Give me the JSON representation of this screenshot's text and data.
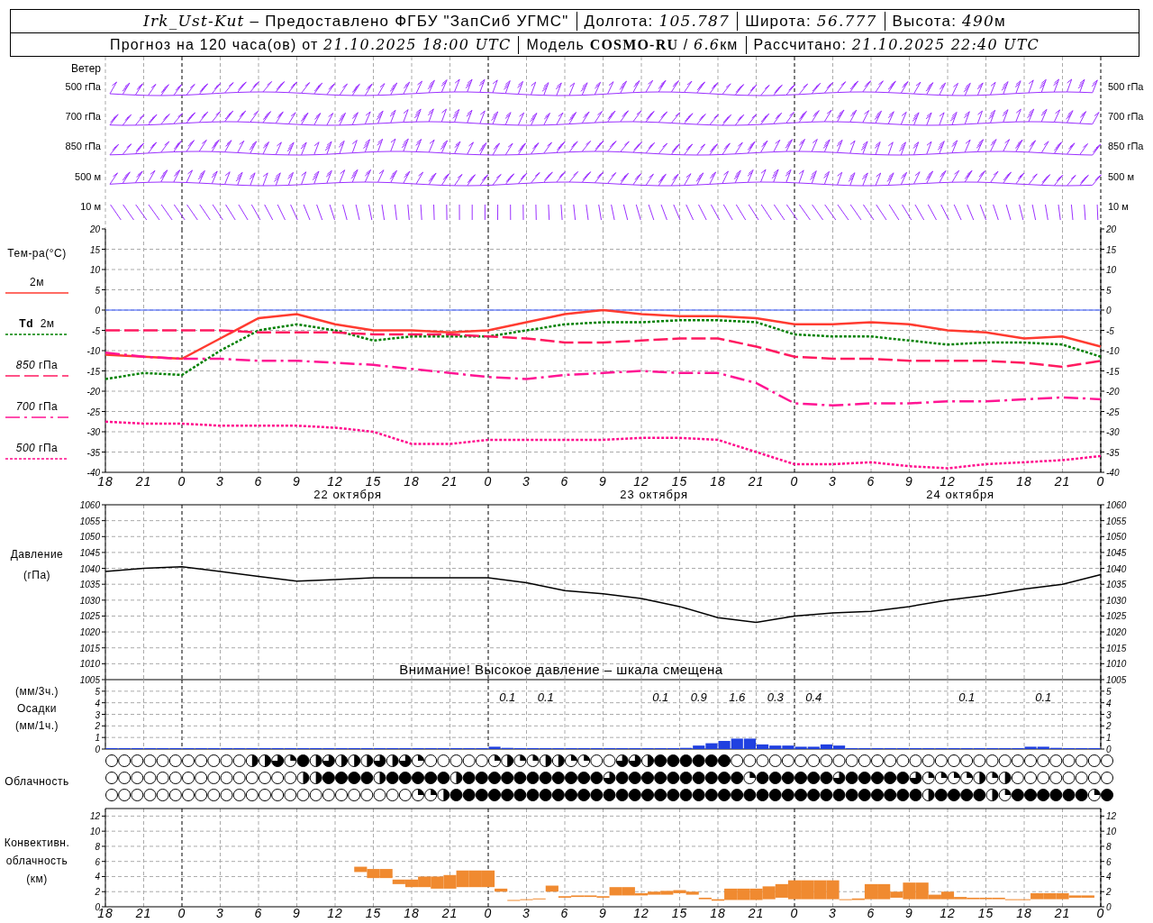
{
  "header": {
    "rows": [
      {
        "segments": [
          {
            "parts": [
              {
                "value": "Irk_Ust-Kut"
              },
              {
                "text": " – Предоставлено ФГБУ \"ЗапСиб УГМС\""
              }
            ]
          },
          {
            "parts": [
              {
                "text": "Долгота: "
              },
              {
                "value": "105.787"
              }
            ]
          },
          {
            "parts": [
              {
                "text": "Широта: "
              },
              {
                "value": "56.777"
              }
            ]
          },
          {
            "parts": [
              {
                "text": "Высота: "
              },
              {
                "value": "490"
              },
              {
                "text": "м"
              }
            ]
          }
        ]
      },
      {
        "segments": [
          {
            "parts": [
              {
                "text": "Прогноз на 120 часа(ов) от "
              },
              {
                "value": "21.10.2025 18:00 UTC"
              }
            ]
          },
          {
            "parts": [
              {
                "text": "Модель "
              },
              {
                "name": "COSMO-RU"
              },
              {
                "text": " / "
              },
              {
                "value": "6.6"
              },
              {
                "text": "км"
              }
            ]
          },
          {
            "parts": [
              {
                "text": "Рассчитано: "
              },
              {
                "value": "21.10.2025 22:40 UTC"
              }
            ]
          }
        ]
      }
    ]
  },
  "wind": {
    "title": "Ветер",
    "levels_left": [
      "500 гПа",
      "700 гПа",
      "850 гПа",
      "500 м",
      "10  м"
    ],
    "levels_right": [
      "500 гПа",
      "700 гПа",
      "850 гПа",
      "500 м",
      "10  м"
    ]
  },
  "temperature": {
    "title": "Тем-ра(°C)",
    "chart_data": {
      "type": "line",
      "grid": true,
      "categories": [
        "18",
        "21",
        "0",
        "3",
        "6",
        "9",
        "12",
        "15",
        "18",
        "21",
        "0",
        "3",
        "6",
        "9",
        "12",
        "15",
        "18",
        "21",
        "0",
        "3",
        "6",
        "9",
        "12",
        "15",
        "18",
        "21",
        "0"
      ],
      "ylim": [
        -40,
        20
      ],
      "yticks": [
        -40,
        -35,
        -30,
        -25,
        -20,
        -15,
        -10,
        -5,
        0,
        5,
        10,
        15,
        20
      ],
      "ref_lines": [
        {
          "axis": "y",
          "value": 0,
          "color": "#3355ff"
        }
      ],
      "series": [
        {
          "name": "2м",
          "color": "#ff3b30",
          "line_style": "solid",
          "values": [
            -11,
            -11.5,
            -12,
            -7,
            -2,
            -1,
            -3.5,
            -5,
            -5,
            -5.5,
            -5,
            -3,
            -1,
            0,
            -1,
            -1.5,
            -1.5,
            -2,
            -3.5,
            -3.5,
            -3,
            -3.5,
            -5,
            -5.5,
            -7,
            -6.5,
            -9
          ]
        },
        {
          "name": "**Td**  2м",
          "color": "#008000",
          "line_style": "dotted",
          "values": [
            -17,
            -15.5,
            -16,
            -10,
            -5,
            -3.5,
            -5,
            -7.5,
            -6.5,
            -6.5,
            -6.5,
            -5,
            -3.5,
            -3,
            -3,
            -2.5,
            -2.5,
            -3,
            -6,
            -6.5,
            -6.5,
            -7.5,
            -8.5,
            -8,
            -8,
            -8.5,
            -11.5
          ]
        },
        {
          "name": "*850* гПа",
          "color": "#ff1a60",
          "line_style": "dashed",
          "values": [
            -5,
            -5,
            -5,
            -5,
            -5.5,
            -5.5,
            -5.5,
            -6,
            -6,
            -6,
            -6.5,
            -7,
            -8,
            -8,
            -7.5,
            -7,
            -7,
            -9,
            -11.5,
            -12,
            -12,
            -12.5,
            -12.5,
            -12.5,
            -13,
            -14,
            -12.5
          ]
        },
        {
          "name": "*700* гПа",
          "color": "#ff1493",
          "line_style": "dashdot",
          "values": [
            -10.5,
            -11.5,
            -12,
            -12,
            -12.5,
            -12.5,
            -13,
            -13.5,
            -14.5,
            -15.5,
            -16.5,
            -17,
            -16,
            -15.5,
            -15,
            -15.5,
            -15.5,
            -18,
            -23,
            -23.5,
            -23,
            -23,
            -22.5,
            -22.5,
            -22,
            -21.5,
            -22
          ]
        },
        {
          "name": "*500* гПа",
          "color": "#ff0a8c",
          "line_style": "dotted",
          "values": [
            -27.5,
            -28,
            -28,
            -28.5,
            -28.5,
            -28.5,
            -29,
            -30,
            -33,
            -33,
            -32,
            -32,
            -32,
            -32,
            -31.5,
            -31.5,
            -32,
            -35,
            -38,
            -38,
            -37.5,
            -38.5,
            -39,
            -38,
            -37.5,
            -37,
            -36
          ]
        }
      ]
    },
    "right_ticks": [
      "20",
      "15",
      "10",
      "5",
      "0",
      "-5",
      "-10",
      "-15",
      "-20",
      "-25",
      "-30",
      "-35",
      "-40"
    ],
    "day_labels": [
      "22 октября",
      "23 октября",
      "24 октября"
    ]
  },
  "pressure": {
    "title": "Давление",
    "unit": "(гПа)",
    "chart_data": {
      "type": "line",
      "grid": true,
      "categories": [
        null,
        null,
        null,
        null,
        null,
        null,
        null,
        null,
        null,
        null,
        null,
        null,
        null,
        null,
        null,
        null,
        null,
        null,
        null,
        null,
        null,
        null,
        null,
        null,
        null,
        null,
        null
      ],
      "ylim": [
        1005,
        1060
      ],
      "yticks": [
        1005,
        1010,
        1015,
        1020,
        1025,
        1030,
        1035,
        1040,
        1045,
        1050,
        1055,
        1060
      ],
      "series": [
        {
          "color": "#000000",
          "values": [
            1039,
            1040,
            1040.5,
            1039,
            1037.5,
            1036,
            1036.5,
            1037,
            1037,
            1037,
            1037,
            1035.5,
            1033,
            1032,
            1030.5,
            1028,
            1024.5,
            1023,
            1025,
            1026,
            1026.5,
            1028,
            1030,
            1031.5,
            1033.5,
            1035,
            1038
          ]
        }
      ]
    },
    "right_ticks": [
      "1060",
      "1055",
      "1050",
      "1045",
      "1040",
      "1035",
      "1030",
      "1025",
      "1020",
      "1015",
      "1010",
      "1005"
    ],
    "warning": "Внимание! Высокое давление – шкала смещена"
  },
  "precipitation": {
    "unit_3h": "(мм/3ч.)",
    "title": "Осадки",
    "unit_1h": "(мм/1ч.)",
    "chart_data": {
      "type": "bar",
      "grid": true,
      "categories": [
        null,
        null,
        null,
        null,
        null,
        null,
        null,
        null,
        null,
        null,
        null,
        null,
        null,
        null,
        null,
        null,
        null,
        null,
        null,
        null,
        null,
        null,
        null,
        null,
        null,
        null,
        null,
        null,
        null,
        null,
        null,
        null,
        null,
        null,
        null,
        null,
        null,
        null,
        null,
        null,
        null,
        null,
        null,
        null,
        null,
        null,
        null,
        null,
        null,
        null,
        null,
        null,
        null,
        null,
        null,
        null,
        null,
        null,
        null,
        null,
        null,
        null,
        null,
        null,
        null,
        null,
        null,
        null,
        null,
        null,
        null,
        null,
        null,
        null,
        null,
        null,
        null,
        null
      ],
      "ylim": [
        0,
        6
      ],
      "yticks": [
        0,
        1,
        2,
        3,
        4,
        5
      ],
      "series": [
        {
          "color": "#2040e0",
          "values": [
            0,
            0,
            0,
            0,
            0,
            0,
            0,
            0,
            0,
            0,
            0,
            0,
            0,
            0,
            0,
            0,
            0,
            0,
            0,
            0,
            0,
            0,
            0,
            0,
            0,
            0,
            0,
            0,
            0,
            0,
            0.2,
            0.1,
            0,
            0,
            0,
            0,
            0.05,
            0,
            0,
            0.05,
            0,
            0,
            0,
            0,
            0.05,
            0.1,
            0.3,
            0.5,
            0.7,
            0.9,
            0.9,
            0.4,
            0.3,
            0.3,
            0.2,
            0.2,
            0.4,
            0.3,
            0,
            0,
            0,
            0,
            0.05,
            0,
            0,
            0,
            0,
            0.05,
            0,
            0,
            0,
            0,
            0.2,
            0.2,
            0.1,
            0,
            0,
            0
          ]
        }
      ],
      "annotations": [
        "0.1",
        "0.1",
        "0.1",
        "0.9",
        "1.6",
        "0.3",
        "0.4",
        "0.1",
        "0.1"
      ]
    },
    "right_ticks": [
      "5",
      "4",
      "3",
      "2",
      "1",
      "0"
    ]
  },
  "clouds": {
    "title": "Облачность",
    "rows": [
      {
        "cells": [
          {
            "kind": "clear"
          },
          {
            "kind": "clear"
          },
          {
            "kind": "clear"
          },
          {
            "kind": "clear"
          },
          {
            "kind": "clear"
          },
          {
            "kind": "clear"
          },
          {
            "kind": "clear"
          },
          {
            "kind": "clear"
          },
          {
            "kind": "clear"
          },
          {
            "kind": "clear"
          },
          {
            "kind": "clear"
          },
          {
            "kind": "half"
          },
          {
            "kind": "half"
          },
          {
            "kind": "threequarter"
          },
          {
            "kind": "quarter"
          },
          {
            "kind": "overcast"
          },
          {
            "kind": "half"
          },
          {
            "kind": "threequarter"
          },
          {
            "kind": "half"
          },
          {
            "kind": "half"
          },
          {
            "kind": "half"
          },
          {
            "kind": "threequarter"
          },
          {
            "kind": "half"
          },
          {
            "kind": "threequarter"
          },
          {
            "kind": "quarter"
          },
          {
            "kind": "clear"
          },
          {
            "kind": "clear"
          },
          {
            "kind": "clear"
          },
          {
            "kind": "clear"
          },
          {
            "kind": "clear"
          },
          {
            "kind": "quarter"
          },
          {
            "kind": "half"
          },
          {
            "kind": "quarter"
          },
          {
            "kind": "quarter"
          },
          {
            "kind": "half"
          },
          {
            "kind": "half"
          },
          {
            "kind": "quarter"
          },
          {
            "kind": "quarter"
          },
          {
            "kind": "clear"
          },
          {
            "kind": "clear"
          },
          {
            "kind": "threequarter"
          },
          {
            "kind": "threequarter"
          },
          {
            "kind": "half"
          },
          {
            "kind": "overcast"
          },
          {
            "kind": "overcast"
          },
          {
            "kind": "overcast"
          },
          {
            "kind": "overcast"
          },
          {
            "kind": "overcast"
          },
          {
            "kind": "overcast"
          },
          {
            "kind": "clear"
          },
          {
            "kind": "clear"
          },
          {
            "kind": "clear"
          },
          {
            "kind": "clear"
          },
          {
            "kind": "clear"
          },
          {
            "kind": "clear"
          },
          {
            "kind": "clear"
          },
          {
            "kind": "clear"
          },
          {
            "kind": "clear"
          },
          {
            "kind": "clear"
          },
          {
            "kind": "clear"
          },
          {
            "kind": "clear"
          },
          {
            "kind": "clear"
          },
          {
            "kind": "clear"
          },
          {
            "kind": "clear"
          },
          {
            "kind": "clear"
          },
          {
            "kind": "clear"
          },
          {
            "kind": "clear"
          },
          {
            "kind": "clear"
          },
          {
            "kind": "clear"
          },
          {
            "kind": "clear"
          },
          {
            "kind": "clear"
          },
          {
            "kind": "clear"
          },
          {
            "kind": "clear"
          },
          {
            "kind": "clear"
          },
          {
            "kind": "clear"
          },
          {
            "kind": "clear"
          },
          {
            "kind": "clear"
          },
          {
            "kind": "clear"
          },
          {
            "kind": "clear"
          }
        ]
      },
      {
        "cells": [
          {
            "kind": "clear"
          },
          {
            "kind": "clear"
          },
          {
            "kind": "clear"
          },
          {
            "kind": "clear"
          },
          {
            "kind": "clear"
          },
          {
            "kind": "clear"
          },
          {
            "kind": "clear"
          },
          {
            "kind": "clear"
          },
          {
            "kind": "clear"
          },
          {
            "kind": "clear"
          },
          {
            "kind": "clear"
          },
          {
            "kind": "clear"
          },
          {
            "kind": "clear"
          },
          {
            "kind": "clear"
          },
          {
            "kind": "clear"
          },
          {
            "kind": "half"
          },
          {
            "kind": "half"
          },
          {
            "kind": "overcast"
          },
          {
            "kind": "overcast"
          },
          {
            "kind": "overcast"
          },
          {
            "kind": "overcast"
          },
          {
            "kind": "half"
          },
          {
            "kind": "overcast"
          },
          {
            "kind": "overcast"
          },
          {
            "kind": "overcast"
          },
          {
            "kind": "overcast"
          },
          {
            "kind": "overcast"
          },
          {
            "kind": "half"
          },
          {
            "kind": "overcast"
          },
          {
            "kind": "overcast"
          },
          {
            "kind": "overcast"
          },
          {
            "kind": "overcast"
          },
          {
            "kind": "overcast"
          },
          {
            "kind": "overcast"
          },
          {
            "kind": "overcast"
          },
          {
            "kind": "overcast"
          },
          {
            "kind": "overcast"
          },
          {
            "kind": "overcast"
          },
          {
            "kind": "overcast"
          },
          {
            "kind": "threequarter"
          },
          {
            "kind": "overcast"
          },
          {
            "kind": "overcast"
          },
          {
            "kind": "overcast"
          },
          {
            "kind": "overcast"
          },
          {
            "kind": "overcast"
          },
          {
            "kind": "overcast"
          },
          {
            "kind": "overcast"
          },
          {
            "kind": "overcast"
          },
          {
            "kind": "overcast"
          },
          {
            "kind": "overcast"
          },
          {
            "kind": "quarter"
          },
          {
            "kind": "overcast"
          },
          {
            "kind": "overcast"
          },
          {
            "kind": "overcast"
          },
          {
            "kind": "overcast"
          },
          {
            "kind": "overcast"
          },
          {
            "kind": "overcast"
          },
          {
            "kind": "threequarter"
          },
          {
            "kind": "overcast"
          },
          {
            "kind": "overcast"
          },
          {
            "kind": "overcast"
          },
          {
            "kind": "overcast"
          },
          {
            "kind": "overcast"
          },
          {
            "kind": "threequarter"
          },
          {
            "kind": "quarter"
          },
          {
            "kind": "quarter"
          },
          {
            "kind": "quarter"
          },
          {
            "kind": "quarter"
          },
          {
            "kind": "half"
          },
          {
            "kind": "quarter"
          },
          {
            "kind": "half"
          },
          {
            "kind": "clear"
          },
          {
            "kind": "clear"
          },
          {
            "kind": "clear"
          },
          {
            "kind": "clear"
          },
          {
            "kind": "clear"
          },
          {
            "kind": "clear"
          },
          {
            "kind": "clear"
          },
          {
            "kind": "clear"
          }
        ]
      },
      {
        "cells": [
          {
            "kind": "clear"
          },
          {
            "kind": "clear"
          },
          {
            "kind": "clear"
          },
          {
            "kind": "clear"
          },
          {
            "kind": "clear"
          },
          {
            "kind": "clear"
          },
          {
            "kind": "clear"
          },
          {
            "kind": "clear"
          },
          {
            "kind": "clear"
          },
          {
            "kind": "clear"
          },
          {
            "kind": "clear"
          },
          {
            "kind": "clear"
          },
          {
            "kind": "clear"
          },
          {
            "kind": "clear"
          },
          {
            "kind": "clear"
          },
          {
            "kind": "clear"
          },
          {
            "kind": "clear"
          },
          {
            "kind": "clear"
          },
          {
            "kind": "clear"
          },
          {
            "kind": "clear"
          },
          {
            "kind": "clear"
          },
          {
            "kind": "clear"
          },
          {
            "kind": "clear"
          },
          {
            "kind": "clear"
          },
          {
            "kind": "quarter"
          },
          {
            "kind": "quarter"
          },
          {
            "kind": "half"
          },
          {
            "kind": "overcast"
          },
          {
            "kind": "overcast"
          },
          {
            "kind": "overcast"
          },
          {
            "kind": "overcast"
          },
          {
            "kind": "overcast"
          },
          {
            "kind": "overcast"
          },
          {
            "kind": "overcast"
          },
          {
            "kind": "overcast"
          },
          {
            "kind": "overcast"
          },
          {
            "kind": "overcast"
          },
          {
            "kind": "overcast"
          },
          {
            "kind": "overcast"
          },
          {
            "kind": "overcast"
          },
          {
            "kind": "overcast"
          },
          {
            "kind": "overcast"
          },
          {
            "kind": "overcast"
          },
          {
            "kind": "overcast"
          },
          {
            "kind": "overcast"
          },
          {
            "kind": "overcast"
          },
          {
            "kind": "overcast"
          },
          {
            "kind": "overcast"
          },
          {
            "kind": "overcast"
          },
          {
            "kind": "overcast"
          },
          {
            "kind": "overcast"
          },
          {
            "kind": "overcast"
          },
          {
            "kind": "overcast"
          },
          {
            "kind": "overcast"
          },
          {
            "kind": "overcast"
          },
          {
            "kind": "overcast"
          },
          {
            "kind": "overcast"
          },
          {
            "kind": "overcast"
          },
          {
            "kind": "overcast"
          },
          {
            "kind": "overcast"
          },
          {
            "kind": "overcast"
          },
          {
            "kind": "overcast"
          },
          {
            "kind": "overcast"
          },
          {
            "kind": "overcast"
          },
          {
            "kind": "half"
          },
          {
            "kind": "overcast"
          },
          {
            "kind": "overcast"
          },
          {
            "kind": "overcast"
          },
          {
            "kind": "overcast"
          },
          {
            "kind": "half"
          },
          {
            "kind": "quarter"
          },
          {
            "kind": "overcast"
          },
          {
            "kind": "overcast"
          },
          {
            "kind": "overcast"
          },
          {
            "kind": "overcast"
          },
          {
            "kind": "overcast"
          },
          {
            "kind": "overcast"
          },
          {
            "kind": "quarter"
          },
          {
            "kind": "overcast"
          }
        ]
      }
    ]
  },
  "convective": {
    "title_lines": [
      "Конвективн.",
      "облачность",
      "(км)"
    ],
    "chart_data": {
      "type": "candlestick",
      "grid": true,
      "categories": [
        "18",
        null,
        null,
        "21",
        null,
        null,
        "0",
        null,
        null,
        "3",
        null,
        null,
        "6",
        null,
        null,
        "9",
        null,
        null,
        "12",
        null,
        null,
        "15",
        null,
        null,
        "18",
        null,
        null,
        "21",
        null,
        null,
        "0",
        null,
        null,
        "3",
        null,
        null,
        "6",
        null,
        null,
        "9",
        null,
        null,
        "12",
        null,
        null,
        "15",
        null,
        null,
        "18",
        null,
        null,
        "21",
        null,
        null,
        "0",
        null,
        null,
        "3",
        null,
        null,
        "6",
        null,
        null,
        "9",
        null,
        null,
        "12",
        null,
        null,
        "15",
        null,
        null,
        "18",
        null,
        null,
        "21",
        null,
        null,
        "0"
      ],
      "ylim": [
        0,
        13
      ],
      "yticks": [
        0,
        2,
        4,
        6,
        8,
        10,
        12
      ],
      "series": [
        {
          "color": "#f08a30",
          "ohlc": [
            null,
            null,
            null,
            null,
            null,
            null,
            null,
            null,
            null,
            null,
            null,
            null,
            null,
            null,
            null,
            null,
            null,
            null,
            null,
            null,
            [
              4.6,
              5.3,
              4.6,
              5.3
            ],
            [
              3.8,
              5.0,
              3.8,
              5.0
            ],
            [
              3.8,
              5.0,
              3.8,
              5.0
            ],
            [
              3.0,
              3.6,
              3.0,
              3.6
            ],
            [
              2.6,
              3.6,
              2.6,
              3.6
            ],
            [
              2.6,
              4.0,
              2.6,
              4.0
            ],
            [
              2.4,
              4.0,
              2.4,
              4.0
            ],
            [
              2.4,
              4.2,
              2.4,
              4.2
            ],
            [
              2.6,
              4.8,
              2.6,
              4.8
            ],
            [
              2.6,
              4.8,
              2.6,
              4.8
            ],
            [
              2.6,
              4.8,
              2.6,
              4.8
            ],
            [
              2.0,
              2.4,
              2.0,
              2.4
            ],
            [
              0.8,
              0.9,
              0.8,
              0.9
            ],
            [
              0.9,
              1.0,
              0.9,
              1.0
            ],
            [
              1.0,
              1.1,
              1.0,
              1.1
            ],
            [
              2.0,
              2.8,
              2.0,
              2.8
            ],
            [
              1.2,
              1.4,
              1.2,
              1.4
            ],
            [
              1.3,
              1.5,
              1.3,
              1.5
            ],
            [
              1.3,
              1.5,
              1.3,
              1.5
            ],
            [
              1.2,
              1.4,
              1.2,
              1.4
            ],
            [
              1.5,
              2.6,
              1.5,
              2.6
            ],
            [
              1.5,
              2.6,
              1.5,
              2.6
            ],
            [
              1.5,
              1.8,
              1.5,
              1.8
            ],
            [
              1.6,
              2.0,
              1.6,
              2.0
            ],
            [
              1.6,
              2.1,
              1.6,
              2.1
            ],
            [
              1.8,
              2.2,
              1.8,
              2.2
            ],
            [
              1.6,
              2.0,
              1.6,
              2.0
            ],
            [
              1.0,
              1.2,
              1.0,
              1.2
            ],
            [
              0.8,
              1.0,
              0.8,
              1.0
            ],
            [
              0.9,
              2.4,
              0.9,
              2.4
            ],
            [
              0.9,
              2.4,
              0.9,
              2.4
            ],
            [
              0.9,
              2.4,
              0.9,
              2.4
            ],
            [
              1.0,
              2.7,
              1.0,
              2.7
            ],
            [
              1.2,
              3.0,
              1.2,
              3.0
            ],
            [
              1.0,
              3.5,
              1.0,
              3.5
            ],
            [
              1.0,
              3.5,
              1.0,
              3.5
            ],
            [
              1.0,
              3.5,
              1.0,
              3.5
            ],
            [
              1.0,
              3.5,
              1.0,
              3.5
            ],
            [
              0.9,
              1.0,
              0.9,
              1.0
            ],
            [
              0.9,
              1.1,
              0.9,
              1.1
            ],
            [
              1.0,
              3.0,
              1.0,
              3.0
            ],
            [
              1.0,
              3.0,
              1.0,
              3.0
            ],
            [
              1.2,
              2.0,
              1.2,
              2.0
            ],
            [
              1.0,
              3.2,
              1.0,
              3.2
            ],
            [
              1.0,
              3.2,
              1.0,
              3.2
            ],
            [
              1.0,
              1.6,
              1.0,
              1.6
            ],
            [
              1.0,
              2.0,
              1.0,
              2.0
            ],
            [
              1.0,
              1.3,
              1.0,
              1.3
            ],
            [
              1.0,
              1.2,
              1.0,
              1.2
            ],
            [
              1.0,
              1.2,
              1.0,
              1.2
            ],
            [
              1.0,
              1.2,
              1.0,
              1.2
            ],
            [
              0.9,
              1.0,
              0.9,
              1.0
            ],
            [
              0.9,
              1.0,
              0.9,
              1.0
            ],
            [
              1.0,
              1.8,
              1.0,
              1.8
            ],
            [
              1.0,
              1.8,
              1.0,
              1.8
            ],
            [
              1.0,
              1.8,
              1.0,
              1.8
            ],
            [
              1.2,
              1.5,
              1.2,
              1.5
            ],
            [
              1.2,
              1.5,
              1.2,
              1.5
            ],
            null
          ]
        }
      ]
    },
    "right_ticks": [
      "12",
      "10",
      "8",
      "6",
      "4",
      "2",
      "0"
    ]
  }
}
